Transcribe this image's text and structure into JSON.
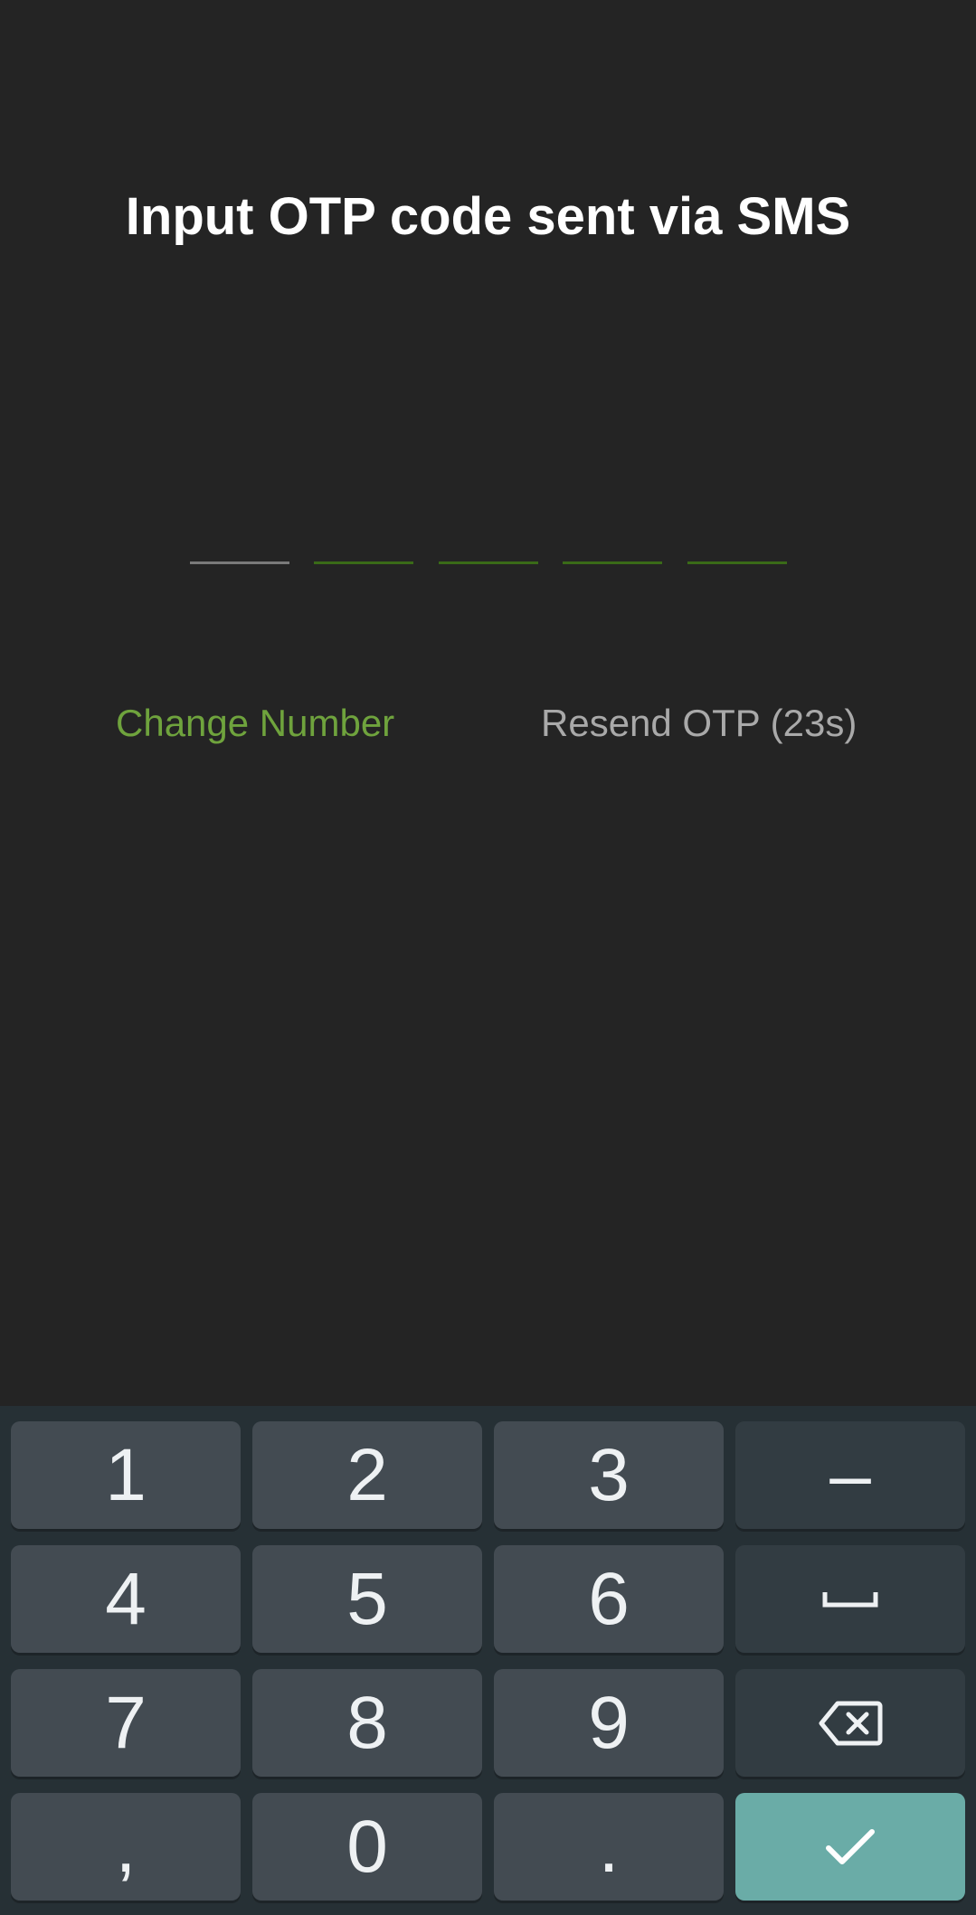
{
  "header": {
    "title": "Input OTP code sent via SMS"
  },
  "otp": {
    "length": 5,
    "digits": [
      "",
      "",
      "",
      "",
      ""
    ]
  },
  "actions": {
    "change_number": "Change Number",
    "resend_otp": "Resend OTP (23s)"
  },
  "keyboard": {
    "rows": [
      [
        "1",
        "2",
        "3",
        "–"
      ],
      [
        "4",
        "5",
        "6",
        "space-icon"
      ],
      [
        "7",
        "8",
        "9",
        "backspace-icon"
      ],
      [
        ",",
        "0",
        ".",
        "check-icon"
      ]
    ]
  },
  "colors": {
    "background": "#242424",
    "accent_green": "#6fa33d",
    "enter_key": "#6aaca7",
    "keyboard_bg": "#263035"
  }
}
